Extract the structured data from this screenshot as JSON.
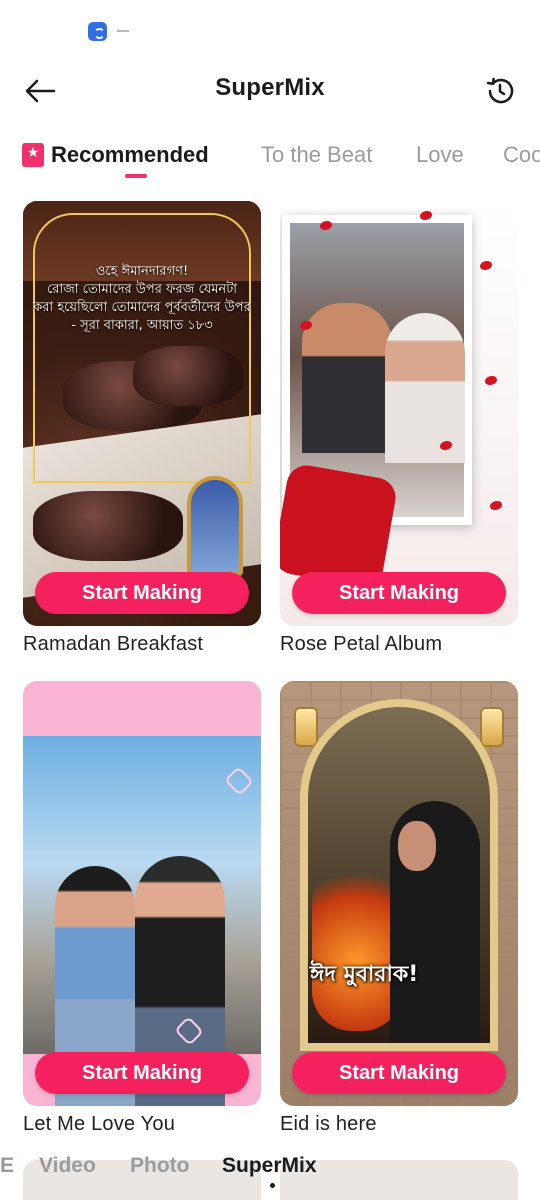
{
  "header": {
    "title": "SuperMix"
  },
  "tabs": [
    {
      "label": "Recommended",
      "active": true
    },
    {
      "label": "To the Beat",
      "active": false
    },
    {
      "label": "Love",
      "active": false
    },
    {
      "label": "Coo",
      "active": false
    }
  ],
  "cards": [
    {
      "title": "Ramadan Breakfast",
      "button": "Start Making",
      "overlay_text": [
        "ওহে ঈমানদারগণ!",
        "রোজা তোমাদের উপর ফরজ যেমনটা",
        "করা হয়েছিলো তোমাদের পূর্ববর্তীদের উপর",
        "- সূরা বাকারা, আয়াত ১৮৩"
      ]
    },
    {
      "title": "Rose Petal Album",
      "button": "Start Making"
    },
    {
      "title": "Let Me Love You",
      "button": "Start Making"
    },
    {
      "title": "Eid is here",
      "button": "Start Making",
      "overlay_text": "ঈদ মুবারাক!"
    }
  ],
  "bottom_tabs": [
    {
      "label": "E",
      "active": false
    },
    {
      "label": "Video",
      "active": false
    },
    {
      "label": "Photo",
      "active": false
    },
    {
      "label": "SuperMix",
      "active": true
    }
  ],
  "colors": {
    "accent": "#f5215f",
    "active_text": "#1b1b1b",
    "inactive_text": "#9b9b9b"
  },
  "icons": {
    "back": "arrow-left-icon",
    "history": "clock-history-icon",
    "recommended": "star-bookmark-icon"
  }
}
